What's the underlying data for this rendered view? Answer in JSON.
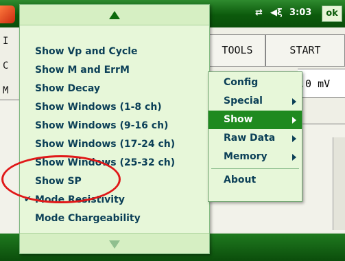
{
  "status_bar": {
    "connectivity_icon": "connectivity-icon",
    "volume_icon": "speaker-icon",
    "time": "3:03",
    "ok_label": "ok"
  },
  "background_app": {
    "tools_label": "TOOLS",
    "start_label": "START",
    "readout": ".0 mV",
    "edge_letters": [
      "I",
      "C",
      "M"
    ]
  },
  "menu": {
    "items": [
      {
        "label": "Show Vp and Cycle",
        "checked": false
      },
      {
        "label": "Show M and ErrM",
        "checked": false
      },
      {
        "label": "Show Decay",
        "checked": false
      },
      {
        "label": "Show Windows (1-8 ch)",
        "checked": false
      },
      {
        "label": "Show Windows (9-16 ch)",
        "checked": false
      },
      {
        "label": "Show Windows (17-24 ch)",
        "checked": false
      },
      {
        "label": "Show Windows (25-32 ch)",
        "checked": false
      },
      {
        "label": "Show SP",
        "checked": false
      },
      {
        "label": "Mode Resistivity",
        "checked": true
      },
      {
        "label": "Mode Chargeability",
        "checked": false
      }
    ],
    "check_mark": "✔"
  },
  "submenu": {
    "items": [
      {
        "label": "Config",
        "has_arrow": false,
        "selected": false
      },
      {
        "label": "Special",
        "has_arrow": true,
        "selected": false
      },
      {
        "label": "Show",
        "has_arrow": true,
        "selected": true
      },
      {
        "label": "Raw Data",
        "has_arrow": true,
        "selected": false
      },
      {
        "label": "Memory",
        "has_arrow": true,
        "selected": false
      },
      {
        "label": "About",
        "has_arrow": false,
        "selected": false
      }
    ]
  },
  "annotation": {
    "color": "#e01818",
    "target": "Show SP"
  }
}
